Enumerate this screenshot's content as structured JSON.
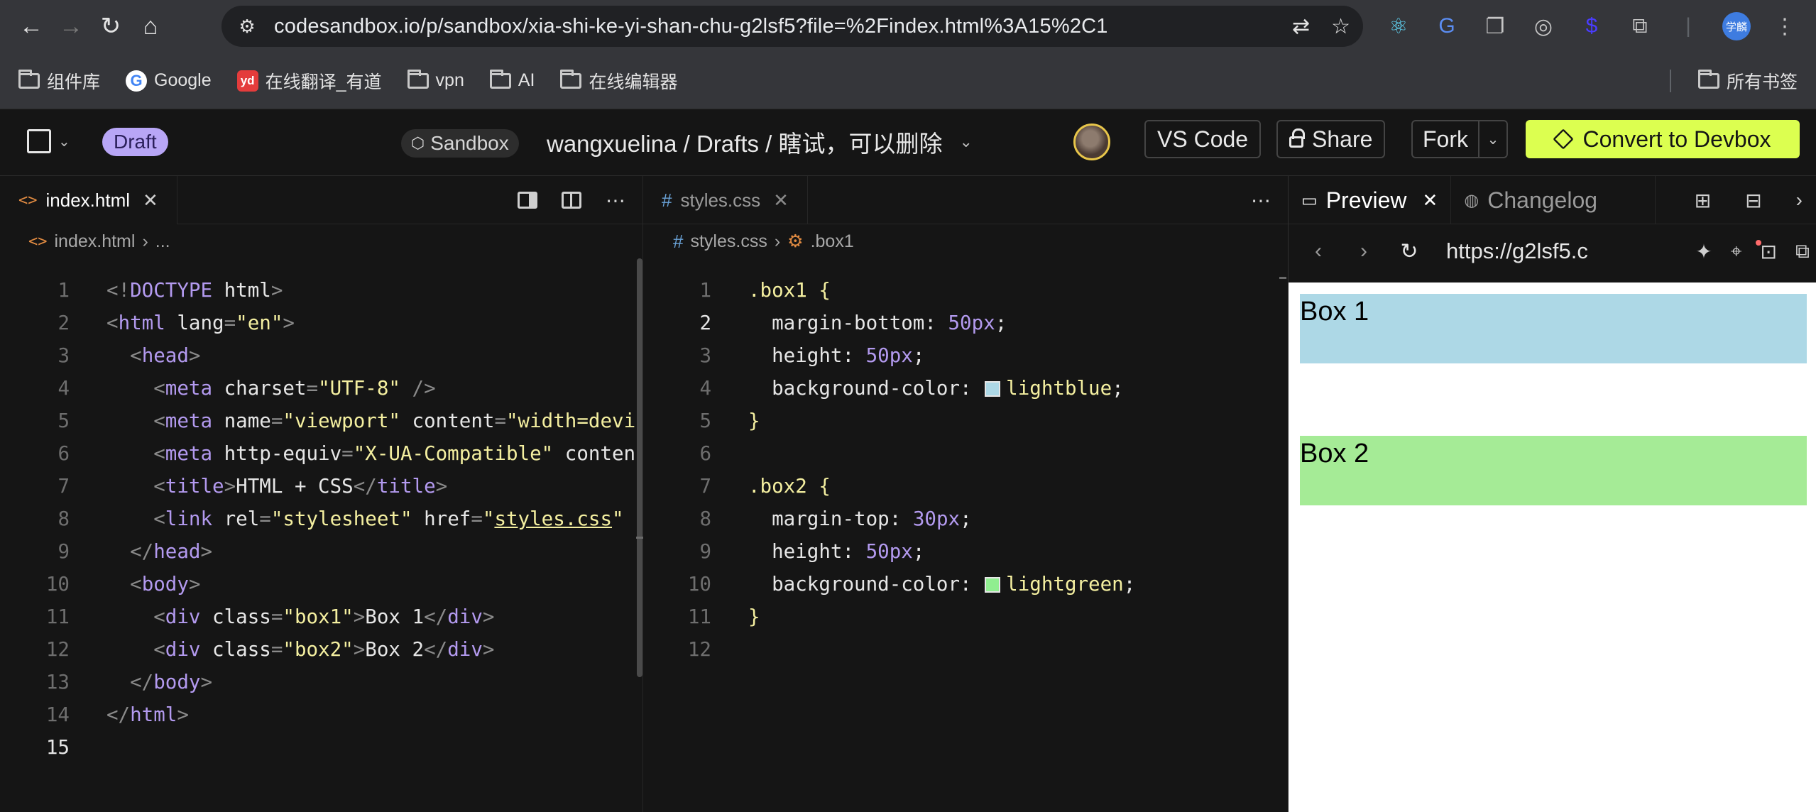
{
  "browser": {
    "url": "codesandbox.io/p/sandbox/xia-shi-ke-yi-shan-chu-g2lsf5?file=%2Findex.html%3A15%2C1",
    "profile_badge": "学麟",
    "bookmarks": [
      {
        "label": "组件库",
        "icon": "folder-icon"
      },
      {
        "label": "Google",
        "icon": "google-icon"
      },
      {
        "label": "在线翻译_有道",
        "icon": "youdao-icon",
        "icon_text": "yd"
      },
      {
        "label": "vpn",
        "icon": "folder-icon"
      },
      {
        "label": "AI",
        "icon": "folder-icon"
      },
      {
        "label": "在线编辑器",
        "icon": "folder-icon"
      }
    ],
    "all_bookmarks": "所有书签"
  },
  "header": {
    "draft_badge": "Draft",
    "sandbox_badge": "Sandbox",
    "path": "wangxuelina / Drafts / 瞎试，可以删除",
    "vscode_button": "VS Code",
    "share_button": "Share",
    "fork_button": "Fork",
    "devbox_button": "Convert to Devbox",
    "accent": "#dcff50"
  },
  "left_editor": {
    "tab": "index.html",
    "tab_glyph": "<>",
    "crumb_file": "index.html",
    "crumb_more": "...",
    "current_line": 15,
    "lines": [
      "<!DOCTYPE html>",
      "<html lang=\"en\">",
      "  <head>",
      "    <meta charset=\"UTF-8\" />",
      "    <meta name=\"viewport\" content=\"width=devi",
      "    <meta http-equiv=\"X-UA-Compatible\" conten",
      "    <title>HTML + CSS</title>",
      "    <link rel=\"stylesheet\" href=\"styles.css\"",
      "  </head>",
      "  <body>",
      "    <div class=\"box1\">Box 1</div>",
      "    <div class=\"box2\">Box 2</div>",
      "  </body>",
      "</html>",
      ""
    ]
  },
  "right_editor": {
    "tab": "styles.css",
    "tab_glyph": "#",
    "crumb_file": "styles.css",
    "crumb_symbol": ".box1",
    "current_line": 2,
    "lines": [
      ".box1 {",
      "  margin-bottom: 50px;",
      "  height: 50px;",
      "  background-color: lightblue;",
      "}",
      "",
      ".box2 {",
      "  margin-top: 30px;",
      "  height: 50px;",
      "  background-color: lightgreen;",
      "}",
      ""
    ],
    "swatches": {
      "lightblue": "#add8e6",
      "lightgreen": "#90ee90"
    }
  },
  "preview": {
    "tab_preview": "Preview",
    "tab_changelog": "Changelog",
    "url": "https://g2lsf5.c",
    "box1_text": "Box 1",
    "box2_text": "Box 2"
  }
}
